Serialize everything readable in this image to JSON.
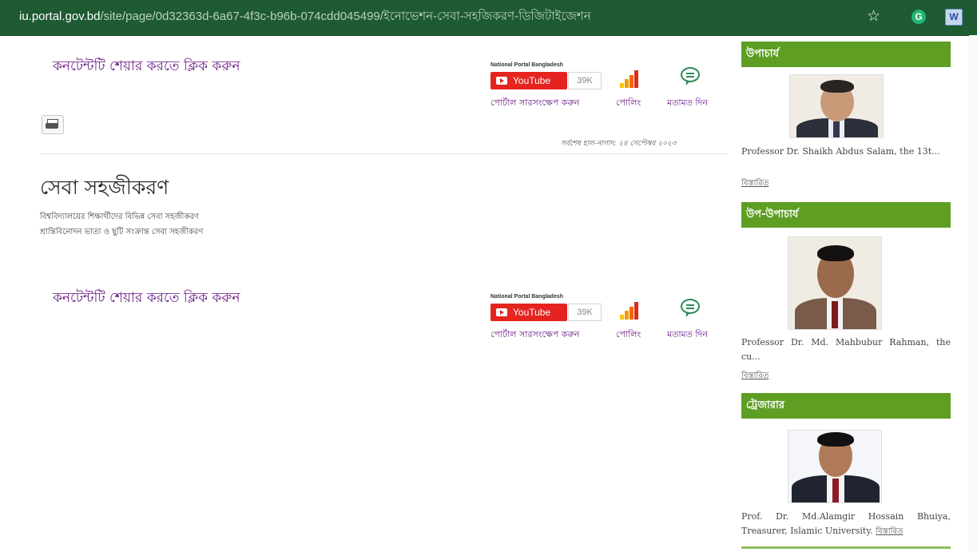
{
  "browser": {
    "url_host": "iu.portal.gov.bd",
    "url_path": "/site/page/0d32363d-6a67-4f3c-b96b-074cdd045499/ইনোভেশন-সেবা-সহজিকরণ-ডিজিটাইজেশন",
    "bookmark_icon": "star-icon",
    "extension_1": "G",
    "extension_2": "W"
  },
  "share_blocks": [
    {
      "title": "কনটেন্টটি শেয়ার করতে ক্লিক করুন",
      "portal_label": "National Portal Bangladesh",
      "youtube_label": "YouTube",
      "youtube_count": "39K",
      "link_admin": "পোর্টাল সারসংক্ষেপ করুন",
      "link_poll": "পোলিং",
      "link_feedback": "মতামত দিন"
    },
    {
      "title": "কনটেন্টটি শেয়ার করতে ক্লিক করুন",
      "portal_label": "National Portal Bangladesh",
      "youtube_label": "YouTube",
      "youtube_count": "39K",
      "link_admin": "পোর্টাল সারসংক্ষেপ করুন",
      "link_poll": "পোলিং",
      "link_feedback": "মতামত দিন"
    }
  ],
  "last_updated": "সর্বশেষ হাল-নাগাদ: ২৪ সেপ্টেম্বর ২০২৩",
  "page_title": "সেবা সহজীকরণ",
  "services": [
    "বিশ্ববিদ্যালয়ের শিক্ষার্থীদের বিভিন্ন সেবা সহজীকরণ",
    "শ্রান্তিবিনোদন ভাতা ও ছুটি সংক্রান্ত সেবা সহজীকরণ"
  ],
  "sidebar": [
    {
      "heading": "উপাচার্য",
      "text": "Professor Dr. Shaikh Abdus Salam, the 13t...",
      "more": "বিস্তারিত"
    },
    {
      "heading": "উপ-উপাচার্য",
      "text": "Professor Dr. Md. Mahbubur Rahman, the cu...",
      "more": "বিস্তারিত"
    },
    {
      "heading": "ট্রেজারার",
      "text": "Prof. Dr. Md.Alamgir Hossain Bhuiya, Treasurer, Islamic University.",
      "more": "বিস্তারিত"
    }
  ],
  "colors": {
    "address_bar": "#1e5a32",
    "sidebar_heading": "#5d9e23",
    "link_purple": "#6a1b86",
    "youtube_red": "#e52420"
  }
}
